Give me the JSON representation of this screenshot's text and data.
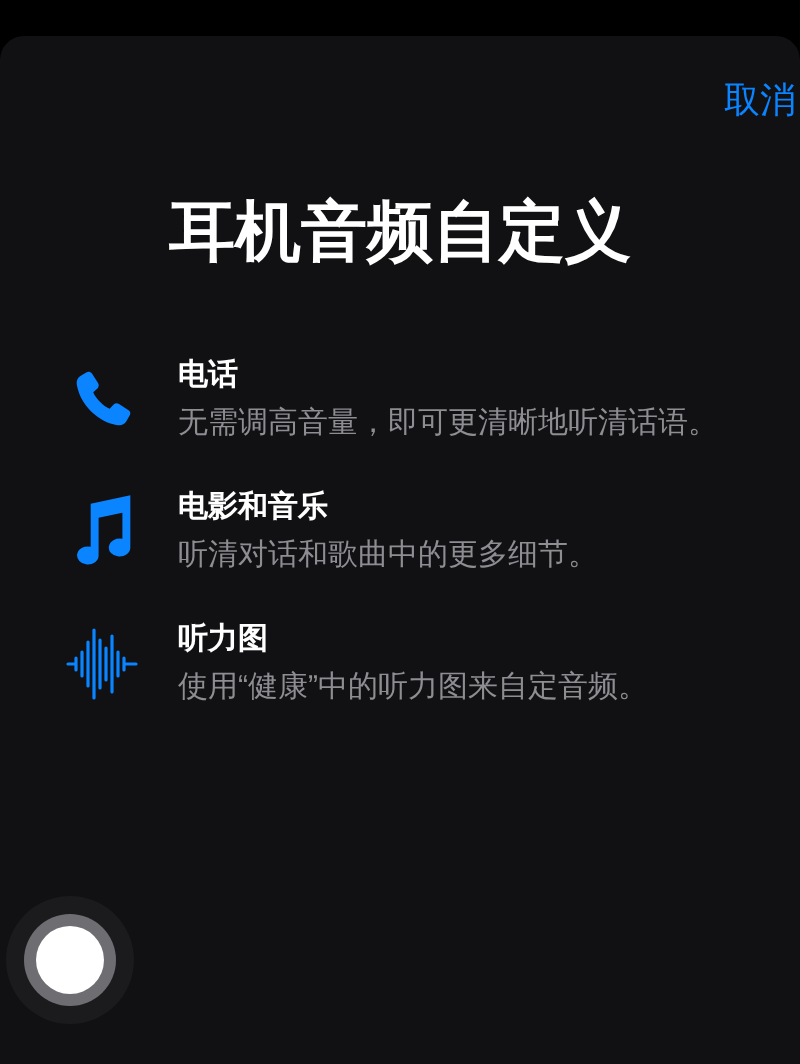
{
  "cancel_button": "取消",
  "title": "耳机音频自定义",
  "options": [
    {
      "kind": "phone",
      "title": "电话",
      "description": "无需调高音量，即可更清晰地听清话语。"
    },
    {
      "kind": "music",
      "title": "电影和音乐",
      "description": "听清对话和歌曲中的更多细节。"
    },
    {
      "kind": "waveform",
      "title": "听力图",
      "description": "使用“健康”中的听力图来自定音频。"
    }
  ]
}
